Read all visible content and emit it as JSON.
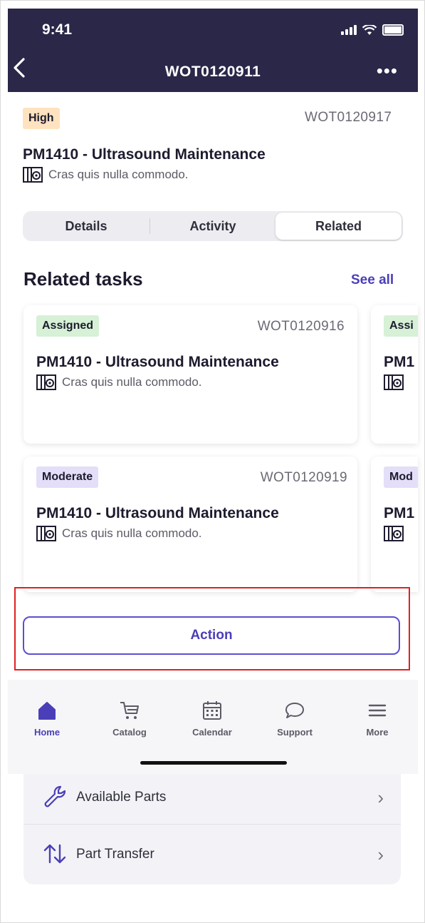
{
  "status_bar": {
    "time": "9:41"
  },
  "nav": {
    "back_icon": "chevron-left-icon",
    "title": "WOT0120911",
    "more_icon": "more-icon",
    "more_glyph": "•••"
  },
  "work_order": {
    "priority": "High",
    "id": "WOT0120917",
    "title": "PM1410 - Ultrasound Maintenance",
    "asset_icon": "asset-icon",
    "subtitle": "Cras quis nulla commodo."
  },
  "tabs": [
    {
      "label": "Details",
      "active": false
    },
    {
      "label": "Activity",
      "active": false
    },
    {
      "label": "Related",
      "active": true
    }
  ],
  "related": {
    "heading": "Related tasks",
    "see_all": "See all",
    "cards": [
      {
        "status": "Assigned",
        "id": "WOT0120916",
        "title": "PM1410 - Ultrasound Maintenance",
        "subtitle": "Cras quis nulla commodo.",
        "status_color": "#d6f1d6"
      },
      {
        "status": "Assi",
        "id": "",
        "title": "PM1",
        "subtitle": "",
        "status_color": "#d6f1d6"
      },
      {
        "status": "Moderate",
        "id": "WOT0120919",
        "title": "PM1410 - Ultrasound Maintenance",
        "subtitle": "Cras quis nulla commodo.",
        "status_color": "#e4def9"
      },
      {
        "status": "Mod",
        "id": "",
        "title": "PM1",
        "subtitle": "",
        "status_color": "#e4def9"
      }
    ]
  },
  "action_button": {
    "label": "Action"
  },
  "tab_bar": [
    {
      "label": "Home",
      "icon": "home-icon",
      "active": true
    },
    {
      "label": "Catalog",
      "icon": "cart-icon",
      "active": false
    },
    {
      "label": "Calendar",
      "icon": "calendar-icon",
      "active": false
    },
    {
      "label": "Support",
      "icon": "chat-bubble-icon",
      "active": false
    },
    {
      "label": "More",
      "icon": "menu-icon",
      "active": false
    }
  ],
  "quick_links": [
    {
      "label": "Available Parts",
      "icon": "wrench-icon",
      "chevron": "›"
    },
    {
      "label": "Part Transfer",
      "icon": "transfer-arrows-icon",
      "chevron": "›"
    }
  ],
  "colors": {
    "header_bg": "#2a2748",
    "accent": "#4a3fb8",
    "highlight_border": "#e02020",
    "badge_high": "#ffe2bf"
  }
}
